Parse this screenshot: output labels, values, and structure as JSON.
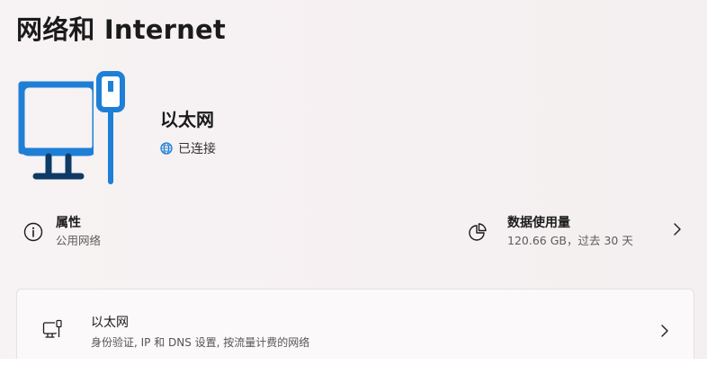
{
  "page": {
    "title": "网络和 Internet"
  },
  "adapter": {
    "name": "以太网",
    "status": "已连接",
    "icon": "ethernet-monitor-icon",
    "accent_color": "#1f7fd6"
  },
  "properties": {
    "label": "属性",
    "value": "公用网络",
    "icon": "info-icon"
  },
  "data_usage": {
    "label": "数据使用量",
    "value": "120.66 GB，过去 30 天",
    "icon": "pie-chart-icon"
  },
  "settings_card": {
    "title": "以太网",
    "subtitle": "身份验证, IP 和 DNS 设置, 按流量计费的网络",
    "icon": "ethernet-icon"
  }
}
